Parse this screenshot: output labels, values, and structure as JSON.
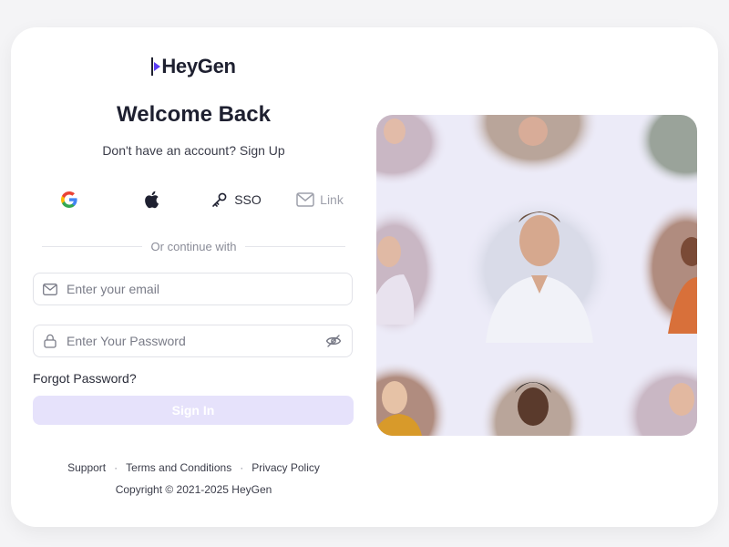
{
  "brand": {
    "name": "HeyGen",
    "accent": "#5b3df5",
    "logo_icon": "play-triangle-icon"
  },
  "auth": {
    "title": "Welcome Back",
    "signup_prompt": "Don't have an account? Sign Up",
    "providers": [
      {
        "name": "Google",
        "icon": "google-icon",
        "label": ""
      },
      {
        "name": "Apple",
        "icon": "apple-icon",
        "label": ""
      },
      {
        "name": "SSO",
        "icon": "key-icon",
        "label": "SSO"
      },
      {
        "name": "Link",
        "icon": "mail-icon",
        "label": "Link",
        "state": "disabled"
      }
    ],
    "divider": "Or continue with",
    "email": {
      "placeholder": "Enter your email",
      "value": "",
      "icon": "mail-icon"
    },
    "password": {
      "placeholder": "Enter Your Password",
      "value": "",
      "icon": "lock-icon",
      "toggle_icon": "eye-off-icon"
    },
    "forgot_label": "Forgot Password?",
    "submit_label": "Sign In",
    "submit_color": "#e6e2fb"
  },
  "footer": {
    "links": [
      "Support",
      "Terms and Conditions",
      "Privacy Policy"
    ],
    "copyright": "Copyright © 2021-2025 HeyGen"
  },
  "hero": {
    "description_icon": "avatar-collage-image",
    "background": "#ecebf8"
  }
}
